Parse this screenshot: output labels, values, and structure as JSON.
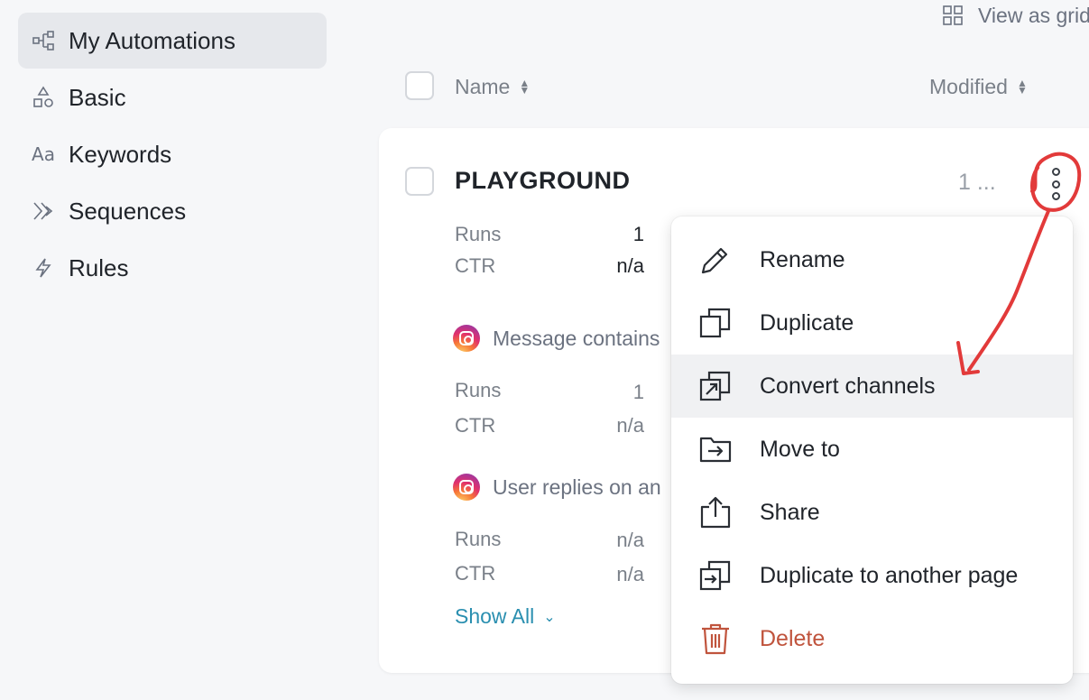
{
  "sidebar": {
    "items": [
      {
        "label": "My Automations",
        "icon": "flow-icon",
        "active": true
      },
      {
        "label": "Basic",
        "icon": "shapes-icon"
      },
      {
        "label": "Keywords",
        "icon": "text-aa-icon",
        "glyph": "Aa"
      },
      {
        "label": "Sequences",
        "icon": "double-chevron-icon"
      },
      {
        "label": "Rules",
        "icon": "lightning-icon"
      }
    ]
  },
  "toolbar": {
    "view_toggle_label": "View as grid"
  },
  "table": {
    "headers": {
      "name": "Name",
      "modified": "Modified"
    }
  },
  "automation": {
    "title": "PLAYGROUND",
    "modified_truncated": "1 ...",
    "summary": {
      "runs_label": "Runs",
      "runs": "1",
      "ctr_label": "CTR",
      "ctr": "n/a"
    },
    "triggers": [
      {
        "label": "Message contains",
        "runs_label": "Runs",
        "runs": "1",
        "ctr_label": "CTR",
        "ctr": "n/a"
      },
      {
        "label": "User replies on an",
        "runs_label": "Runs",
        "runs": "n/a",
        "ctr_label": "CTR",
        "ctr": "n/a"
      }
    ],
    "show_all_label": "Show All"
  },
  "context_menu": {
    "items": [
      {
        "label": "Rename",
        "icon": "pencil-icon"
      },
      {
        "label": "Duplicate",
        "icon": "duplicate-icon"
      },
      {
        "label": "Convert channels",
        "icon": "convert-icon",
        "highlighted": true
      },
      {
        "label": "Move to",
        "icon": "folder-move-icon"
      },
      {
        "label": "Share",
        "icon": "share-icon"
      },
      {
        "label": "Duplicate to another page",
        "icon": "duplicate-page-icon"
      },
      {
        "label": "Delete",
        "icon": "trash-icon",
        "danger": true
      }
    ]
  },
  "colors": {
    "accent": "#2a8fb0",
    "danger": "#c0543d",
    "annotation": "#e23a3a"
  }
}
